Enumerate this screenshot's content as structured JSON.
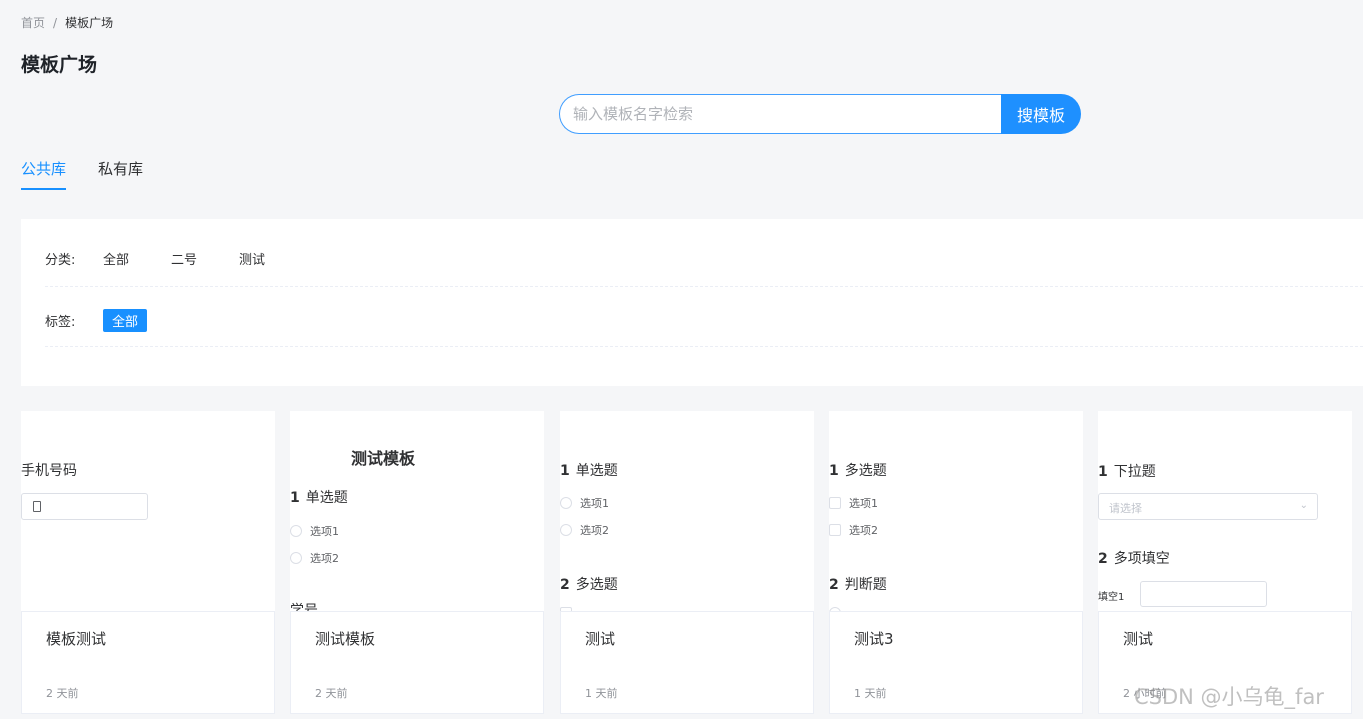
{
  "breadcrumb": {
    "home": "首页",
    "separator": "/",
    "current": "模板广场"
  },
  "page": {
    "title": "模板广场"
  },
  "search": {
    "placeholder": "输入模板名字检索",
    "button_label": "搜模板"
  },
  "tabs": [
    {
      "label": "公共库",
      "active": true
    },
    {
      "label": "私有库",
      "active": false
    }
  ],
  "filters": {
    "category_label": "分类:",
    "categories": [
      "全部",
      "二号",
      "测试"
    ],
    "tag_label": "标签:",
    "tags": [
      "全部"
    ]
  },
  "cards": [
    {
      "name": "模板测试",
      "time": "2 天前",
      "preview": {
        "field_label": "手机号码"
      }
    },
    {
      "name": "测试模板",
      "time": "2 天前",
      "preview": {
        "heading": "测试模板",
        "q1_num": "1",
        "q1_title": "单选题",
        "options": [
          "选项1",
          "选项2"
        ],
        "partial_label": "学号"
      }
    },
    {
      "name": "测试",
      "time": "1 天前",
      "preview": {
        "q1_num": "1",
        "q1_title": "单选题",
        "options": [
          "选项1",
          "选项2"
        ],
        "q2_num": "2",
        "q2_title": "多选题"
      }
    },
    {
      "name": "测试3",
      "time": "1 天前",
      "preview": {
        "q1_num": "1",
        "q1_title": "多选题",
        "options": [
          "选项1",
          "选项2"
        ],
        "q2_num": "2",
        "q2_title": "判断题"
      }
    },
    {
      "name": "测试",
      "time": "2 小时前",
      "preview": {
        "q1_num": "1",
        "q1_title": "下拉题",
        "select_placeholder": "请选择",
        "q2_num": "2",
        "q2_title": "多项填空",
        "fill_label": "填空1"
      }
    }
  ],
  "watermark": "CSDN @小乌龟_far",
  "icons": {
    "phone": "phone-icon",
    "dropdown": "chevron-down-icon"
  },
  "colors": {
    "accent": "#1890ff",
    "background": "#f5f6f8"
  }
}
